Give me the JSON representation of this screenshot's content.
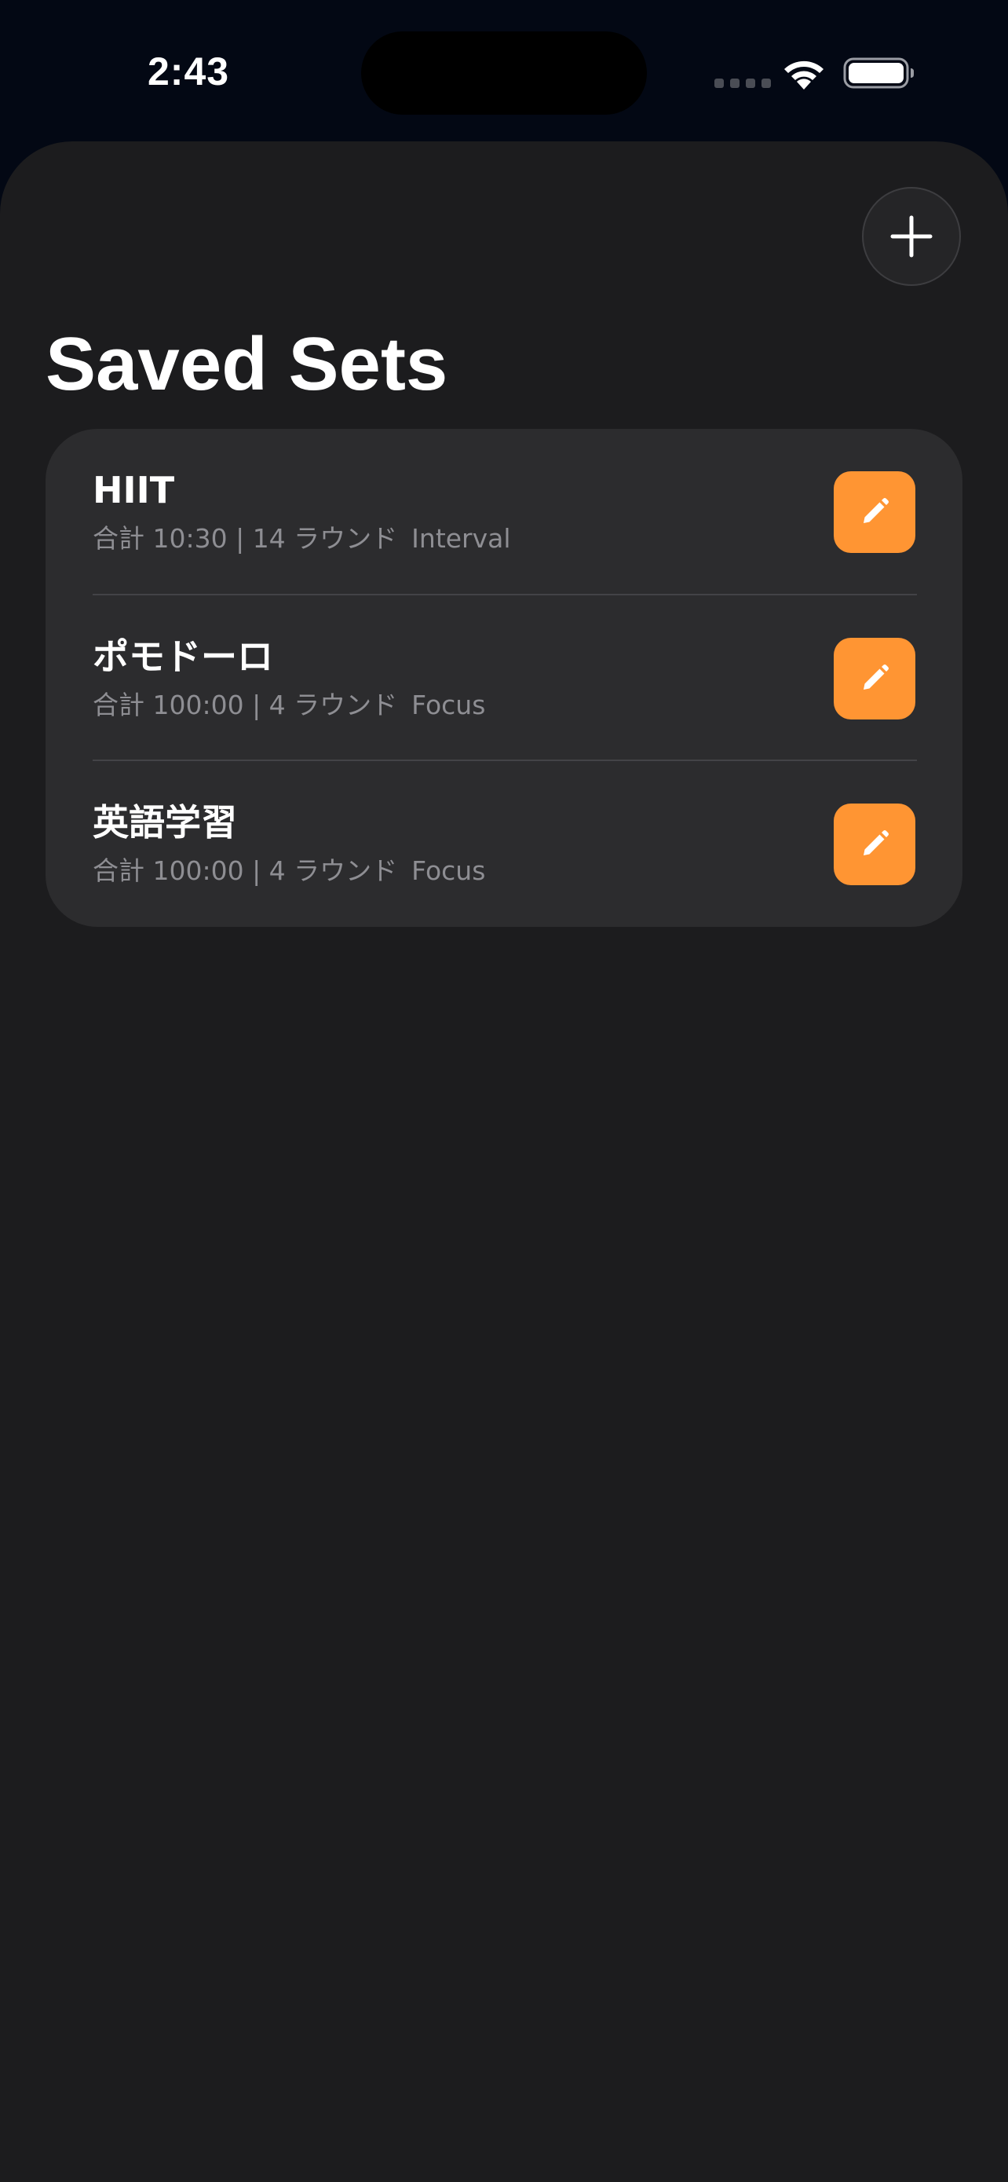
{
  "status_bar": {
    "time": "2:43",
    "wifi_icon": "wifi-icon",
    "battery_icon": "battery-icon"
  },
  "header": {
    "add_icon": "plus-icon",
    "title": "Saved Sets"
  },
  "sets": [
    {
      "name": "HIIT",
      "summary": "合計 10:30 | 14 ラウンド",
      "tag": "Interval",
      "edit_icon": "pencil-icon"
    },
    {
      "name": "ポモドーロ",
      "summary": "合計 100:00 | 4 ラウンド",
      "tag": "Focus",
      "edit_icon": "pencil-icon"
    },
    {
      "name": "英語学習",
      "summary": "合計 100:00 | 4 ラウンド",
      "tag": "Focus",
      "edit_icon": "pencil-icon"
    }
  ],
  "colors": {
    "accent": "#ff9533",
    "sheet_background": "#1c1c1e",
    "card_background": "#2c2c2e",
    "secondary_text": "#8e8e93"
  }
}
